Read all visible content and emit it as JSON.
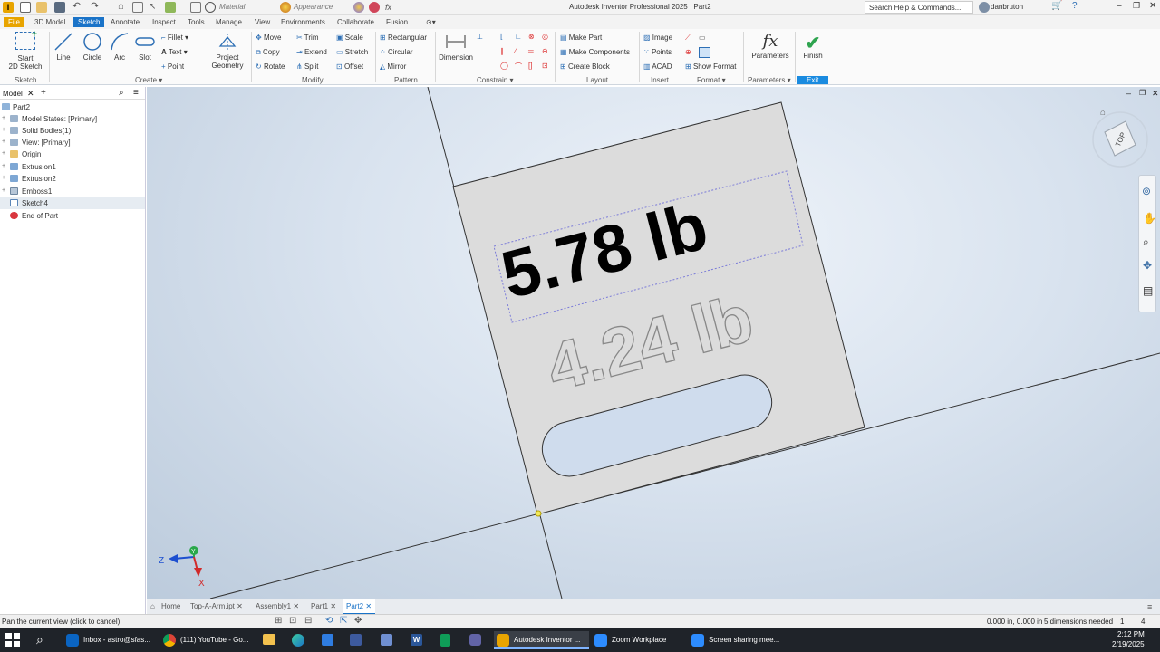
{
  "app": {
    "title": "Autodesk Inventor Professional 2025",
    "document": "Part2",
    "material": "Material",
    "appearance": "Appearance",
    "search_placeholder": "Search Help & Commands...",
    "user": "danbruton"
  },
  "menu_tabs": [
    "File",
    "3D Model",
    "Sketch",
    "Annotate",
    "Inspect",
    "Tools",
    "Manage",
    "View",
    "Environments",
    "Collaborate",
    "Fusion"
  ],
  "ribbon": {
    "start_sketch": "Start\n2D Sketch",
    "line": "Line",
    "circle": "Circle",
    "arc": "Arc",
    "slot": "Slot",
    "fillet": "Fillet",
    "text": "Text",
    "point": "Point",
    "project_geometry": "Project\nGeometry",
    "move": "Move",
    "copy": "Copy",
    "rotate": "Rotate",
    "trim": "Trim",
    "extend": "Extend",
    "split": "Split",
    "scale": "Scale",
    "stretch": "Stretch",
    "offset": "Offset",
    "rectangular": "Rectangular",
    "circular": "Circular",
    "mirror": "Mirror",
    "dimension": "Dimension",
    "make_part": "Make Part",
    "make_components": "Make Components",
    "create_block": "Create Block",
    "image": "Image",
    "points": "Points",
    "acad": "ACAD",
    "show_format": "Show Format",
    "parameters": "Parameters",
    "finish": "Finish",
    "groups": {
      "sketch": "Sketch",
      "create": "Create",
      "modify": "Modify",
      "pattern": "Pattern",
      "constrain": "Constrain",
      "layout": "Layout",
      "insert": "Insert",
      "format": "Format",
      "parameters": "Parameters",
      "exit": "Exit"
    }
  },
  "browser": {
    "tab": "Model",
    "items": [
      {
        "label": "Part2",
        "icon": "part-icon"
      },
      {
        "label": "Model States: [Primary]",
        "icon": "folder-icon"
      },
      {
        "label": "Solid Bodies(1)",
        "icon": "folder-icon"
      },
      {
        "label": "View: [Primary]",
        "icon": "folder-icon"
      },
      {
        "label": "Origin",
        "icon": "folder-icon"
      },
      {
        "label": "Extrusion1",
        "icon": "extrude-icon"
      },
      {
        "label": "Extrusion2",
        "icon": "extrude-icon"
      },
      {
        "label": "Emboss1",
        "icon": "emboss-icon"
      },
      {
        "label": "Sketch4",
        "icon": "sketch-icon"
      },
      {
        "label": "End of Part",
        "icon": "end-of-part-icon"
      }
    ]
  },
  "viewport": {
    "text_filled": "5.78 lb",
    "text_outline": "4.24 lb",
    "viewcube_label": "TOP",
    "axis_x": "X",
    "axis_y": "Y",
    "axis_z": "Z"
  },
  "doc_tabs": [
    "Home",
    "Top-A-Arm.ipt",
    "Assembly1",
    "Part1",
    "Part2"
  ],
  "status": {
    "hint": "Pan the current view (click to cancel)",
    "coords": "0.000 in, 0.000 in",
    "dims": "5 dimensions needed",
    "num1": "1",
    "num2": "4"
  },
  "taskbar": {
    "items": [
      "Inbox - astro@sfas...",
      "(111) YouTube - Go...",
      "Autodesk Inventor ...",
      "Zoom Workplace",
      "Screen sharing mee..."
    ],
    "time": "2:12 PM",
    "date": "2/19/2025"
  }
}
